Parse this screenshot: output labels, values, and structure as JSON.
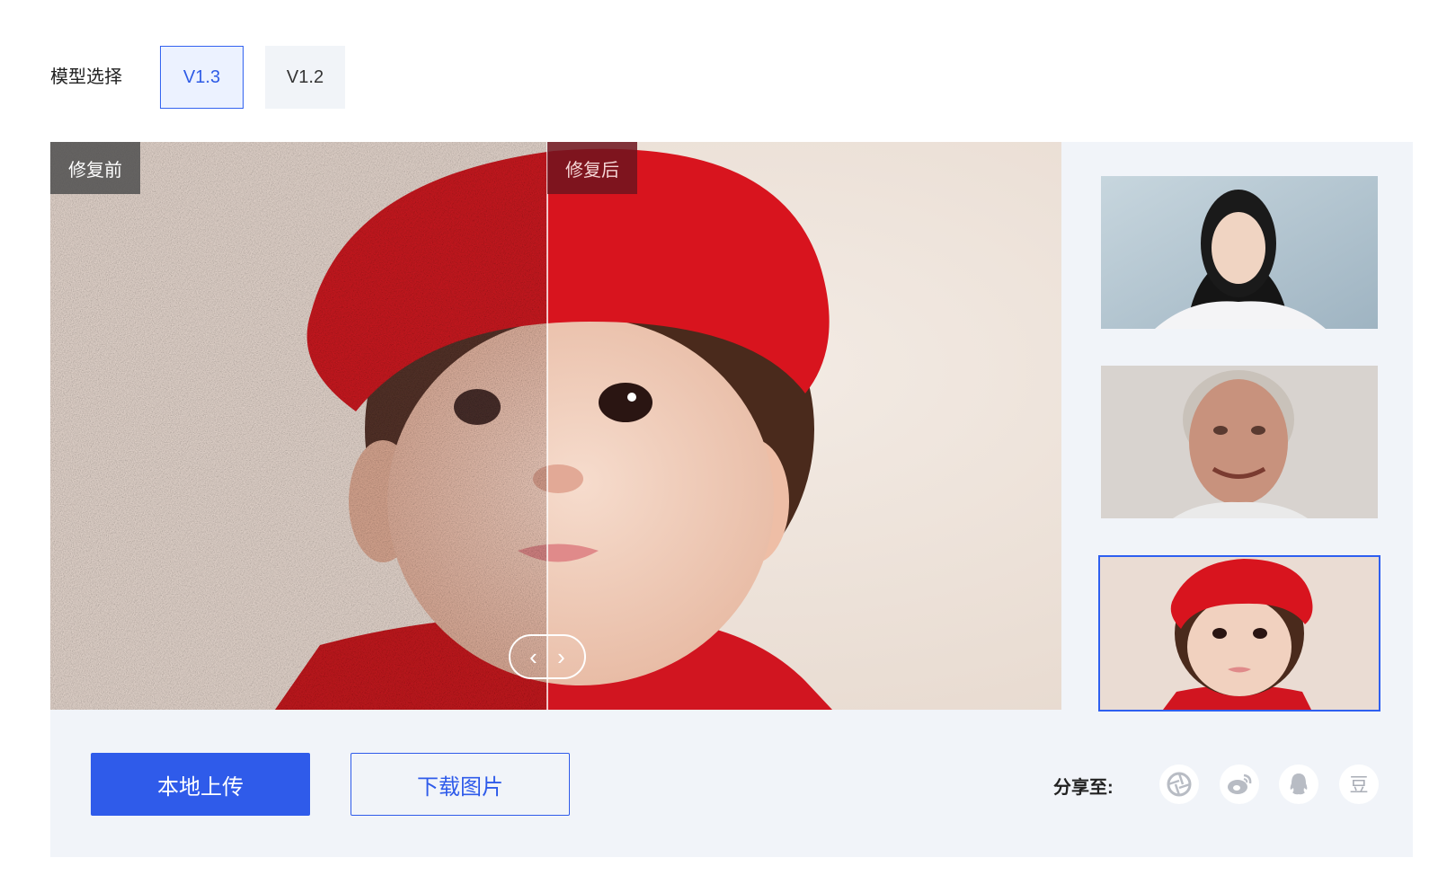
{
  "model": {
    "label": "模型选择",
    "options": [
      "V1.3",
      "V1.2"
    ],
    "selected": "V1.3"
  },
  "viewer": {
    "before_label": "修复前",
    "after_label": "修复后",
    "handle_left": "‹",
    "handle_right": "›"
  },
  "thumbnails": [
    {
      "name": "young woman portrait"
    },
    {
      "name": "elderly man portrait"
    },
    {
      "name": "baby in red hat",
      "selected": true
    }
  ],
  "actions": {
    "upload_label": "本地上传",
    "download_label": "下载图片"
  },
  "share": {
    "label": "分享至:",
    "icons": [
      "aperture-icon",
      "weibo-icon",
      "qq-icon",
      "douban-icon"
    ],
    "douban_glyph": "豆"
  },
  "colors": {
    "accent": "#2f5bea",
    "panel_bg": "#f1f4f9",
    "hat_red": "#d8141e"
  }
}
